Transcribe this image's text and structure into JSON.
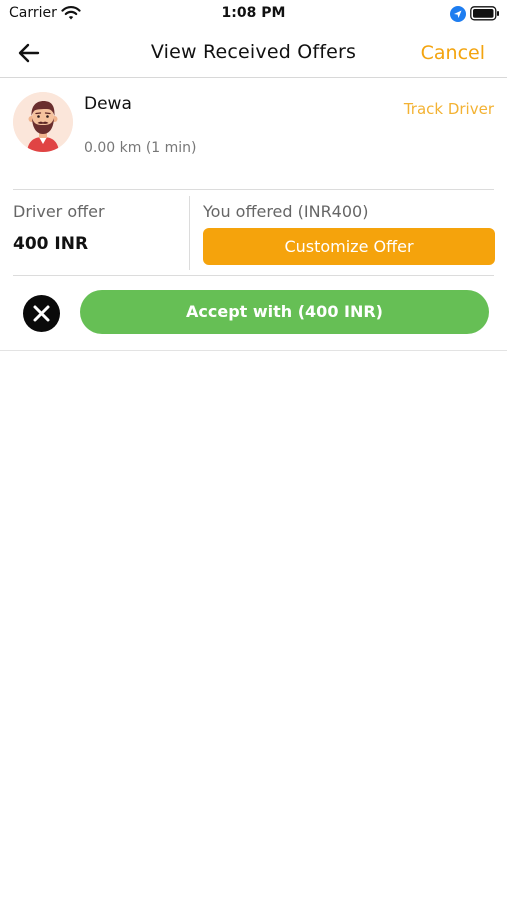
{
  "status_bar": {
    "carrier": "Carrier",
    "time": "1:08 PM",
    "icons": [
      "wifi-icon",
      "location-icon",
      "battery-icon"
    ]
  },
  "nav": {
    "title": "View Received Offers",
    "cancel_label": "Cancel",
    "back_icon": "back-arrow-icon"
  },
  "driver": {
    "name": "Dewa",
    "eta": "0.00 km (1 min)",
    "track_label": "Track Driver",
    "avatar_icon": "driver-avatar"
  },
  "offer": {
    "driver_offer_label": "Driver offer",
    "driver_offer_value": "400 INR",
    "you_offered_label": "You offered (INR400)",
    "customize_label": "Customize Offer"
  },
  "actions": {
    "accept_label": "Accept with (400 INR)",
    "reject_icon": "close-icon"
  },
  "colors": {
    "accent": "#f5a30c",
    "accept": "#66bf55",
    "link": "#f3b233"
  }
}
